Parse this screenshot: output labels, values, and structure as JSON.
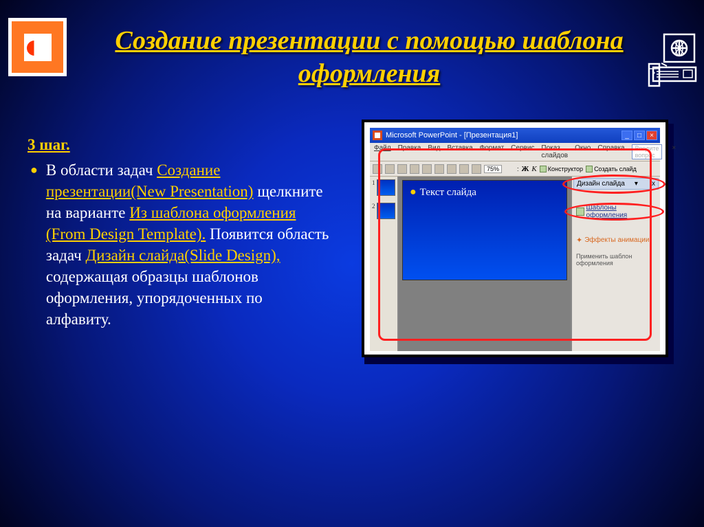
{
  "title": "Создание презентации с помощью шаблона оформления",
  "step": "3 шаг.",
  "body": {
    "t1": "В области задач ",
    "l1": "Создание презентации(New Presentation)",
    "t2": " щелкните на варианте ",
    "l2": "Из шаблона оформления (From Design Template).",
    "t3": " Появится область задач ",
    "l3": "Дизайн слайда(Slide Design),",
    "t4": " содержащая образцы шаблонов оформления, упорядоченных по алфавиту."
  },
  "screenshot": {
    "titlebar": "Microsoft PowerPoint - [Презентация1]",
    "menu": [
      "Файл",
      "Правка",
      "Вид",
      "Вставка",
      "Формат",
      "Сервис",
      "Показ слайдов",
      "Окно",
      "Справка"
    ],
    "helpPlaceholder": "Введите вопрос",
    "zoom": "75%",
    "format_b": "Ж",
    "format_i": "К",
    "tb_konstruktor": "Конструктор",
    "tb_create": "Создать слайд",
    "slideText": "Текст слайда",
    "thumb1": "1",
    "thumb2": "2",
    "taskpane": {
      "header": "Дизайн слайда",
      "close": "x",
      "item1": "Шаблоны оформления",
      "item2": "Эффекты анимации",
      "item3": "Применить шаблон оформления"
    }
  }
}
